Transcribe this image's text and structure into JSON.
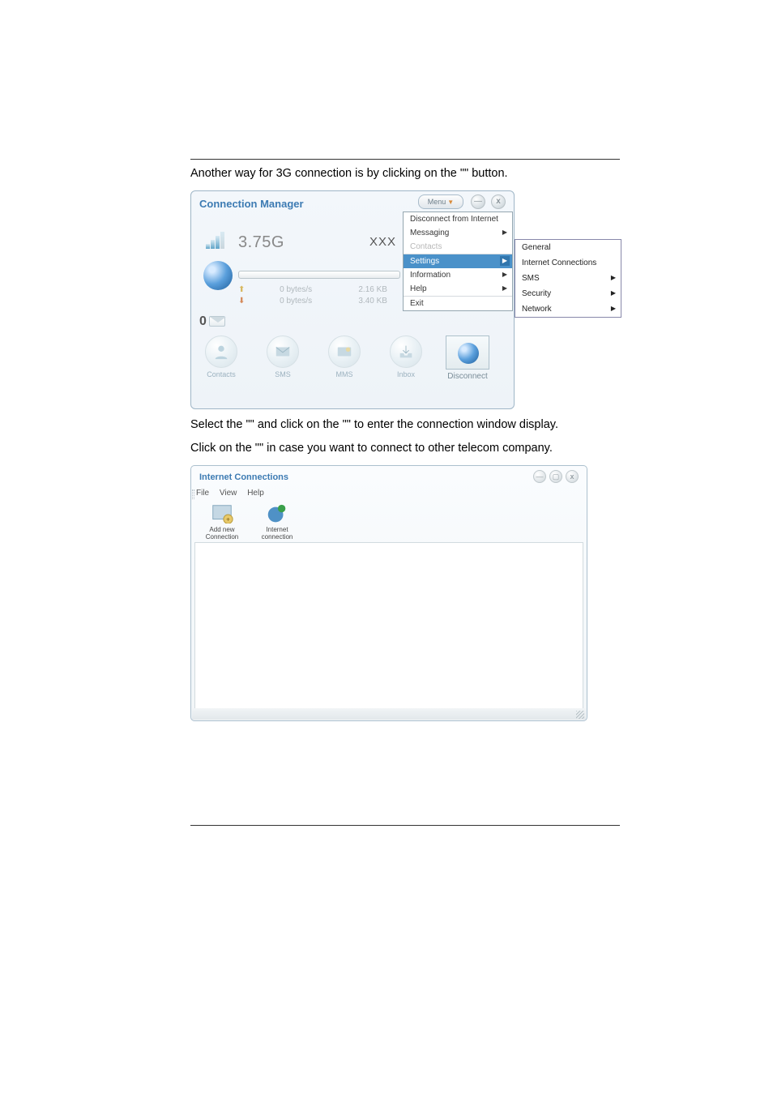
{
  "para1_a": "Another way for 3G connection is by clicking on the \"",
  "para1_b": "\" button.",
  "fig1": {
    "title": "Connection Manager",
    "menu_btn": "Menu",
    "network": "3.75G",
    "provider": "XXX",
    "up_rate": "0 bytes/s",
    "up_total": "2.16 KB",
    "dn_rate": "0 bytes/s",
    "dn_total": "3.40 KB",
    "counter": "0",
    "icons": {
      "contacts": "Contacts",
      "sms": "SMS",
      "mms": "MMS",
      "inbox": "Inbox",
      "disconnect": "Disconnect"
    },
    "dropdown": {
      "disconnect": "Disconnect from Internet",
      "messaging": "Messaging",
      "contacts": "Contacts",
      "settings": "Settings",
      "information": "Information",
      "help": "Help",
      "exit": "Exit"
    },
    "submenu": {
      "general": "General",
      "ic": "Internet Connections",
      "sms": "SMS",
      "security": "Security",
      "network": "Network"
    }
  },
  "para2_a": "Select the \"",
  "para2_b": "\" and click on the \"",
  "para2_c": "\" to enter the connection window display.",
  "para3_a": "Click on the \"",
  "para3_b": "\" in case you want to connect to other telecom company.",
  "fig2": {
    "title": "Internet Connections",
    "menubar": {
      "file": "File",
      "view": "View",
      "help": "Help"
    },
    "tools": {
      "add": "Add new Connection",
      "ic": "Internet connection"
    }
  }
}
